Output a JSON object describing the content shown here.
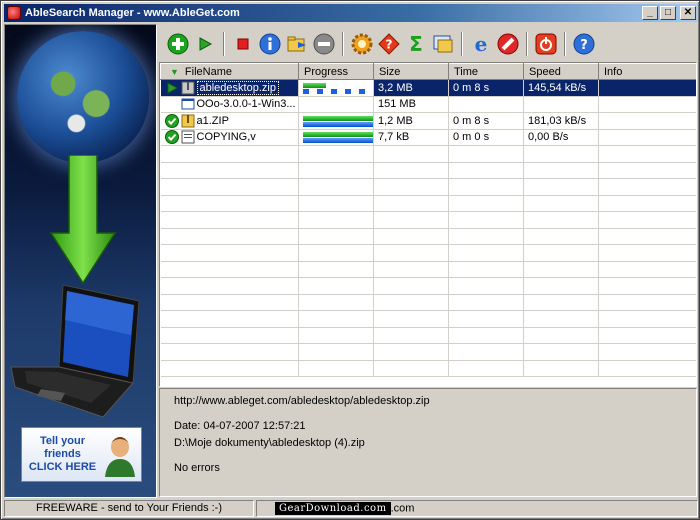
{
  "window": {
    "title": "AbleSearch Manager - www.AbleGet.com",
    "buttons": {
      "minimize": "_",
      "maximize": "□",
      "close": "✕"
    }
  },
  "promo": {
    "tell_friends": [
      "Tell your",
      "friends",
      "CLICK HERE"
    ]
  },
  "toolbar": {
    "buttons": [
      {
        "name": "add",
        "icon": "plus-green-icon"
      },
      {
        "name": "start",
        "icon": "play-green-icon"
      },
      {
        "name": "stop",
        "icon": "stop-red-icon"
      },
      {
        "name": "info",
        "icon": "info-blue-icon"
      },
      {
        "name": "move",
        "icon": "folder-move-icon"
      },
      {
        "name": "remove",
        "icon": "minus-gray-icon"
      },
      {
        "name": "settings",
        "icon": "gear-icon"
      },
      {
        "name": "help",
        "icon": "question-red-icon"
      },
      {
        "name": "sum",
        "icon": "sigma-icon"
      },
      {
        "name": "transfer",
        "icon": "transfer-icon"
      },
      {
        "name": "browser",
        "icon": "ie-icon"
      },
      {
        "name": "block",
        "icon": "no-entry-icon"
      },
      {
        "name": "power",
        "icon": "power-icon"
      },
      {
        "name": "about",
        "icon": "question-blue-icon"
      }
    ]
  },
  "columns": {
    "filename": "FileName",
    "progress": "Progress",
    "size": "Size",
    "time": "Time",
    "speed": "Speed",
    "info": "Info"
  },
  "files": [
    {
      "status": "downloading",
      "name": "abledesktop.zip",
      "progress": 0.33,
      "progress_style": "segments",
      "size": "3,2 MB",
      "time": "0 m 8 s",
      "speed": "145,54 kB/s",
      "info": "",
      "selected": true
    },
    {
      "status": "queued",
      "name": "OOo-3.0.0-1-Win3...",
      "progress": 0,
      "progress_style": "none",
      "size": "151 MB",
      "time": "",
      "speed": "",
      "info": "",
      "selected": false
    },
    {
      "status": "done",
      "name": "a1.ZIP",
      "progress": 1,
      "progress_style": "full",
      "size": "1,2 MB",
      "time": "0 m 8 s",
      "speed": "181,03 kB/s",
      "info": "",
      "selected": false
    },
    {
      "status": "done",
      "name": "COPYING,v",
      "progress": 1,
      "progress_style": "full",
      "size": "7,7 kB",
      "time": "0 m 0 s",
      "speed": "0,00 B/s",
      "info": "",
      "selected": false
    }
  ],
  "details": {
    "url": "http://www.ableget.com/abledesktop/abledesktop.zip",
    "date": "Date:  04-07-2007 12:57:21",
    "path": "D:\\Moje dokumenty\\abledesktop (4).zip",
    "errors": "No errors"
  },
  "statusbar": {
    "main": "FREEWARE - send to Your Friends :-)",
    "watermark": "GearDownload.com",
    "suffix": ".com"
  },
  "colors": {
    "titlebar_start": "#0a246a",
    "selection": "#0a246a",
    "progress_green": "#109010",
    "progress_blue": "#0050d0"
  }
}
